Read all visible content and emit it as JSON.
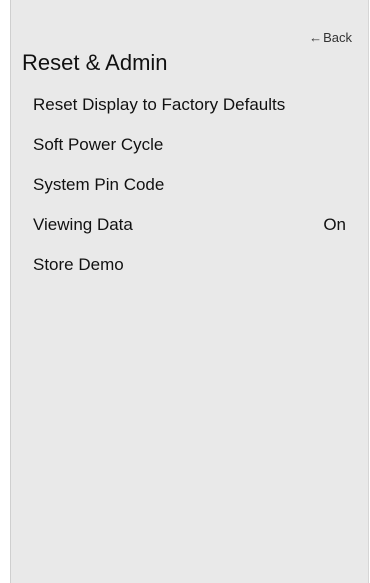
{
  "header": {
    "back_arrow": "←",
    "back_label": "Back",
    "title": "Reset & Admin"
  },
  "menu": {
    "items": [
      {
        "label": "Reset Display to Factory Defaults",
        "value": ""
      },
      {
        "label": "Soft Power Cycle",
        "value": ""
      },
      {
        "label": "System Pin Code",
        "value": ""
      },
      {
        "label": "Viewing Data",
        "value": "On"
      },
      {
        "label": "Store Demo",
        "value": ""
      }
    ]
  }
}
